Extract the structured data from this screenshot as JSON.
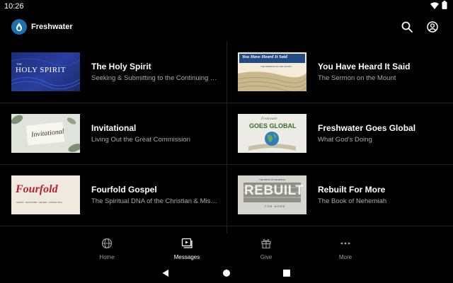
{
  "status_bar": {
    "time": "10:26"
  },
  "app_bar": {
    "title": "Freshwater"
  },
  "series": [
    {
      "title": "The Holy Spirit",
      "subtitle": "Seeking & Submitting to the Continuing Work of the Holy Spirit",
      "thumb_text": "HOLY SPIRIT",
      "thumb_prefix": "THE"
    },
    {
      "title": "You Have Heard It Said",
      "subtitle": "The Sermon on the Mount",
      "thumb_text": "You Have Heard It Said",
      "thumb_caption": "THE SERMON ON THE MOUNT"
    },
    {
      "title": "Invitational",
      "subtitle": "Living Out the Great Commission",
      "thumb_text": "Invitational"
    },
    {
      "title": "Freshwater Goes Global",
      "subtitle": "What God's Doing",
      "thumb_text": "GOES GLOBAL",
      "thumb_prefix": "Freshwater"
    },
    {
      "title": "Fourfold Gospel",
      "subtitle": "The Spiritual DNA of the Christian & Missionary Alliance",
      "thumb_text": "Fourfold",
      "thumb_caption": "SAVIOR · SANCTIFIER · HEALER · COMING KING"
    },
    {
      "title": "Rebuilt For More",
      "subtitle": "The Book of Nehemiah",
      "thumb_text": "REBUILT",
      "thumb_prefix": "THE BOOK OF NEHEMIAH",
      "thumb_caption": "FOR MORE"
    }
  ],
  "bottom_nav": {
    "items": [
      {
        "label": "Home",
        "icon": "globe-icon"
      },
      {
        "label": "Messages",
        "icon": "video-library-icon"
      },
      {
        "label": "Give",
        "icon": "gift-icon"
      },
      {
        "label": "More",
        "icon": "more-horizontal-icon"
      }
    ],
    "active": "Messages"
  },
  "colors": {
    "background": "#000000",
    "subtitle": "#a8a8a8",
    "divider": "#222222",
    "brand": "#1f6fae"
  }
}
